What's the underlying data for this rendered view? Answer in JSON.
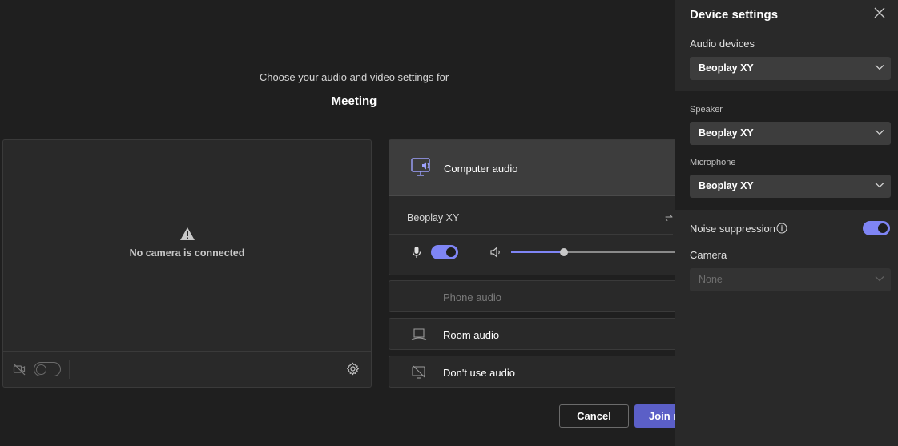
{
  "header": {
    "subtitle": "Choose your audio and video settings for",
    "title": "Meeting"
  },
  "video": {
    "message": "No camera is connected",
    "camera_toggle": "off"
  },
  "audio_options": {
    "computer": {
      "label": "Computer audio",
      "device": "Beoplay XY",
      "mic_toggle": "on",
      "volume_fraction": 0.3
    },
    "phone": {
      "label": "Phone audio"
    },
    "room": {
      "label": "Room audio"
    },
    "none": {
      "label": "Don't use audio"
    }
  },
  "buttons": {
    "cancel": "Cancel",
    "join": "Join n"
  },
  "device_settings": {
    "title": "Device settings",
    "audio_devices_label": "Audio devices",
    "audio_devices_value": "Beoplay XY",
    "speaker_label": "Speaker",
    "speaker_value": "Beoplay XY",
    "microphone_label": "Microphone",
    "microphone_value": "Beoplay XY",
    "noise_suppression_label": "Noise suppression",
    "noise_suppression": "on",
    "camera_label": "Camera",
    "camera_value": "None"
  },
  "colors": {
    "accent": "#7f85f5",
    "primary_button": "#5b5fc7",
    "background": "#1f1f1f",
    "panel": "#292929"
  }
}
